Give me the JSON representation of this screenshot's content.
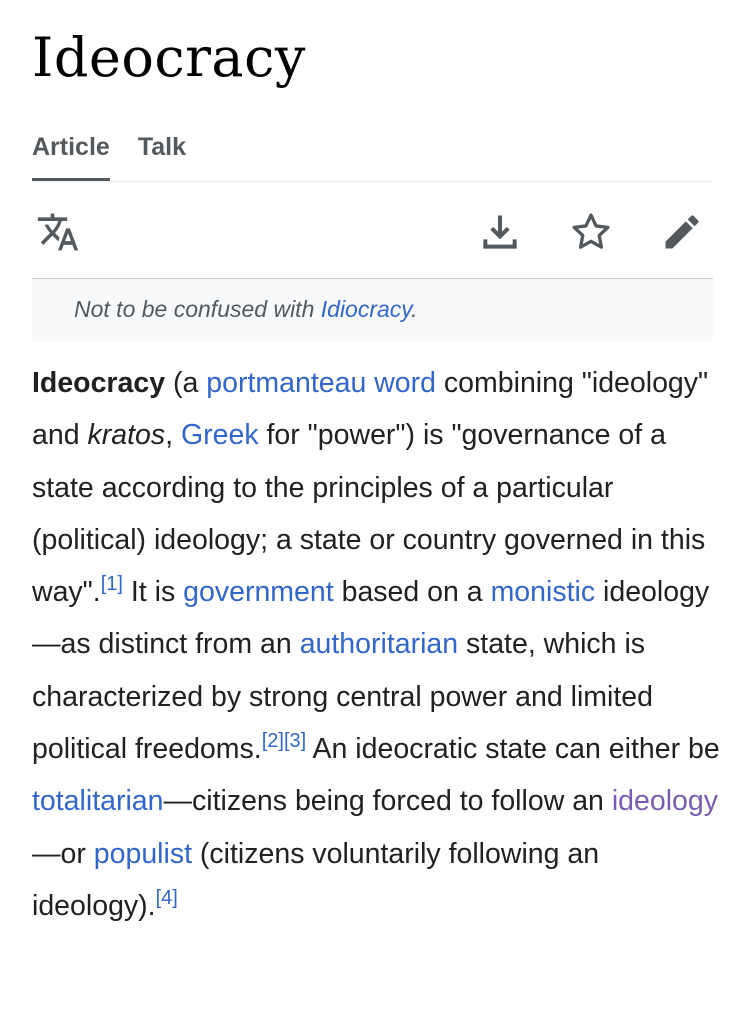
{
  "page": {
    "title": "Ideocracy"
  },
  "tabs": [
    {
      "label": "Article",
      "active": true
    },
    {
      "label": "Talk",
      "active": false
    }
  ],
  "toolbar": {
    "icons": [
      "language-icon",
      "download-icon",
      "star-icon",
      "edit-pencil-icon"
    ],
    "icon_color": "#54595d"
  },
  "hatnote": {
    "prefix": "Not to be confused with ",
    "link": "Idiocracy",
    "suffix": "."
  },
  "article": {
    "segments": [
      {
        "t": "Ideocracy",
        "type": "bold"
      },
      {
        "t": " (a ",
        "type": "text"
      },
      {
        "t": "portmanteau word",
        "type": "link"
      },
      {
        "t": " combining \"ideology\" and ",
        "type": "text"
      },
      {
        "t": "kratos",
        "type": "italic"
      },
      {
        "t": ", ",
        "type": "text"
      },
      {
        "t": "Greek",
        "type": "link"
      },
      {
        "t": " for \"power\") is \"governance of a state according to the principles of a particular (political) ideology; a state or country governed in this way\".",
        "type": "text"
      },
      {
        "t": "[1]",
        "type": "ref"
      },
      {
        "t": " It is ",
        "type": "text"
      },
      {
        "t": "government",
        "type": "link"
      },
      {
        "t": " based on a ",
        "type": "text"
      },
      {
        "t": "monistic",
        "type": "link"
      },
      {
        "t": " ideology—as distinct from an ",
        "type": "text"
      },
      {
        "t": "authoritarian",
        "type": "link"
      },
      {
        "t": " state, which is characterized by strong central power and limited political freedoms.",
        "type": "text"
      },
      {
        "t": "[2]",
        "type": "ref"
      },
      {
        "t": "[3]",
        "type": "ref"
      },
      {
        "t": " An ideocratic state can either be ",
        "type": "text"
      },
      {
        "t": "totalitarian",
        "type": "link"
      },
      {
        "t": "—citizens being forced to follow an ",
        "type": "text"
      },
      {
        "t": "ideology",
        "type": "visited-link"
      },
      {
        "t": "—or ",
        "type": "text"
      },
      {
        "t": "populist",
        "type": "link"
      },
      {
        "t": " (citizens voluntarily following an ideology).",
        "type": "text"
      },
      {
        "t": "[4]",
        "type": "ref"
      }
    ]
  },
  "colors": {
    "link": "#3366cc",
    "visited_link": "#795cb2",
    "text": "#202122",
    "muted": "#54595d",
    "hatnote_bg": "#f8f9fa"
  }
}
